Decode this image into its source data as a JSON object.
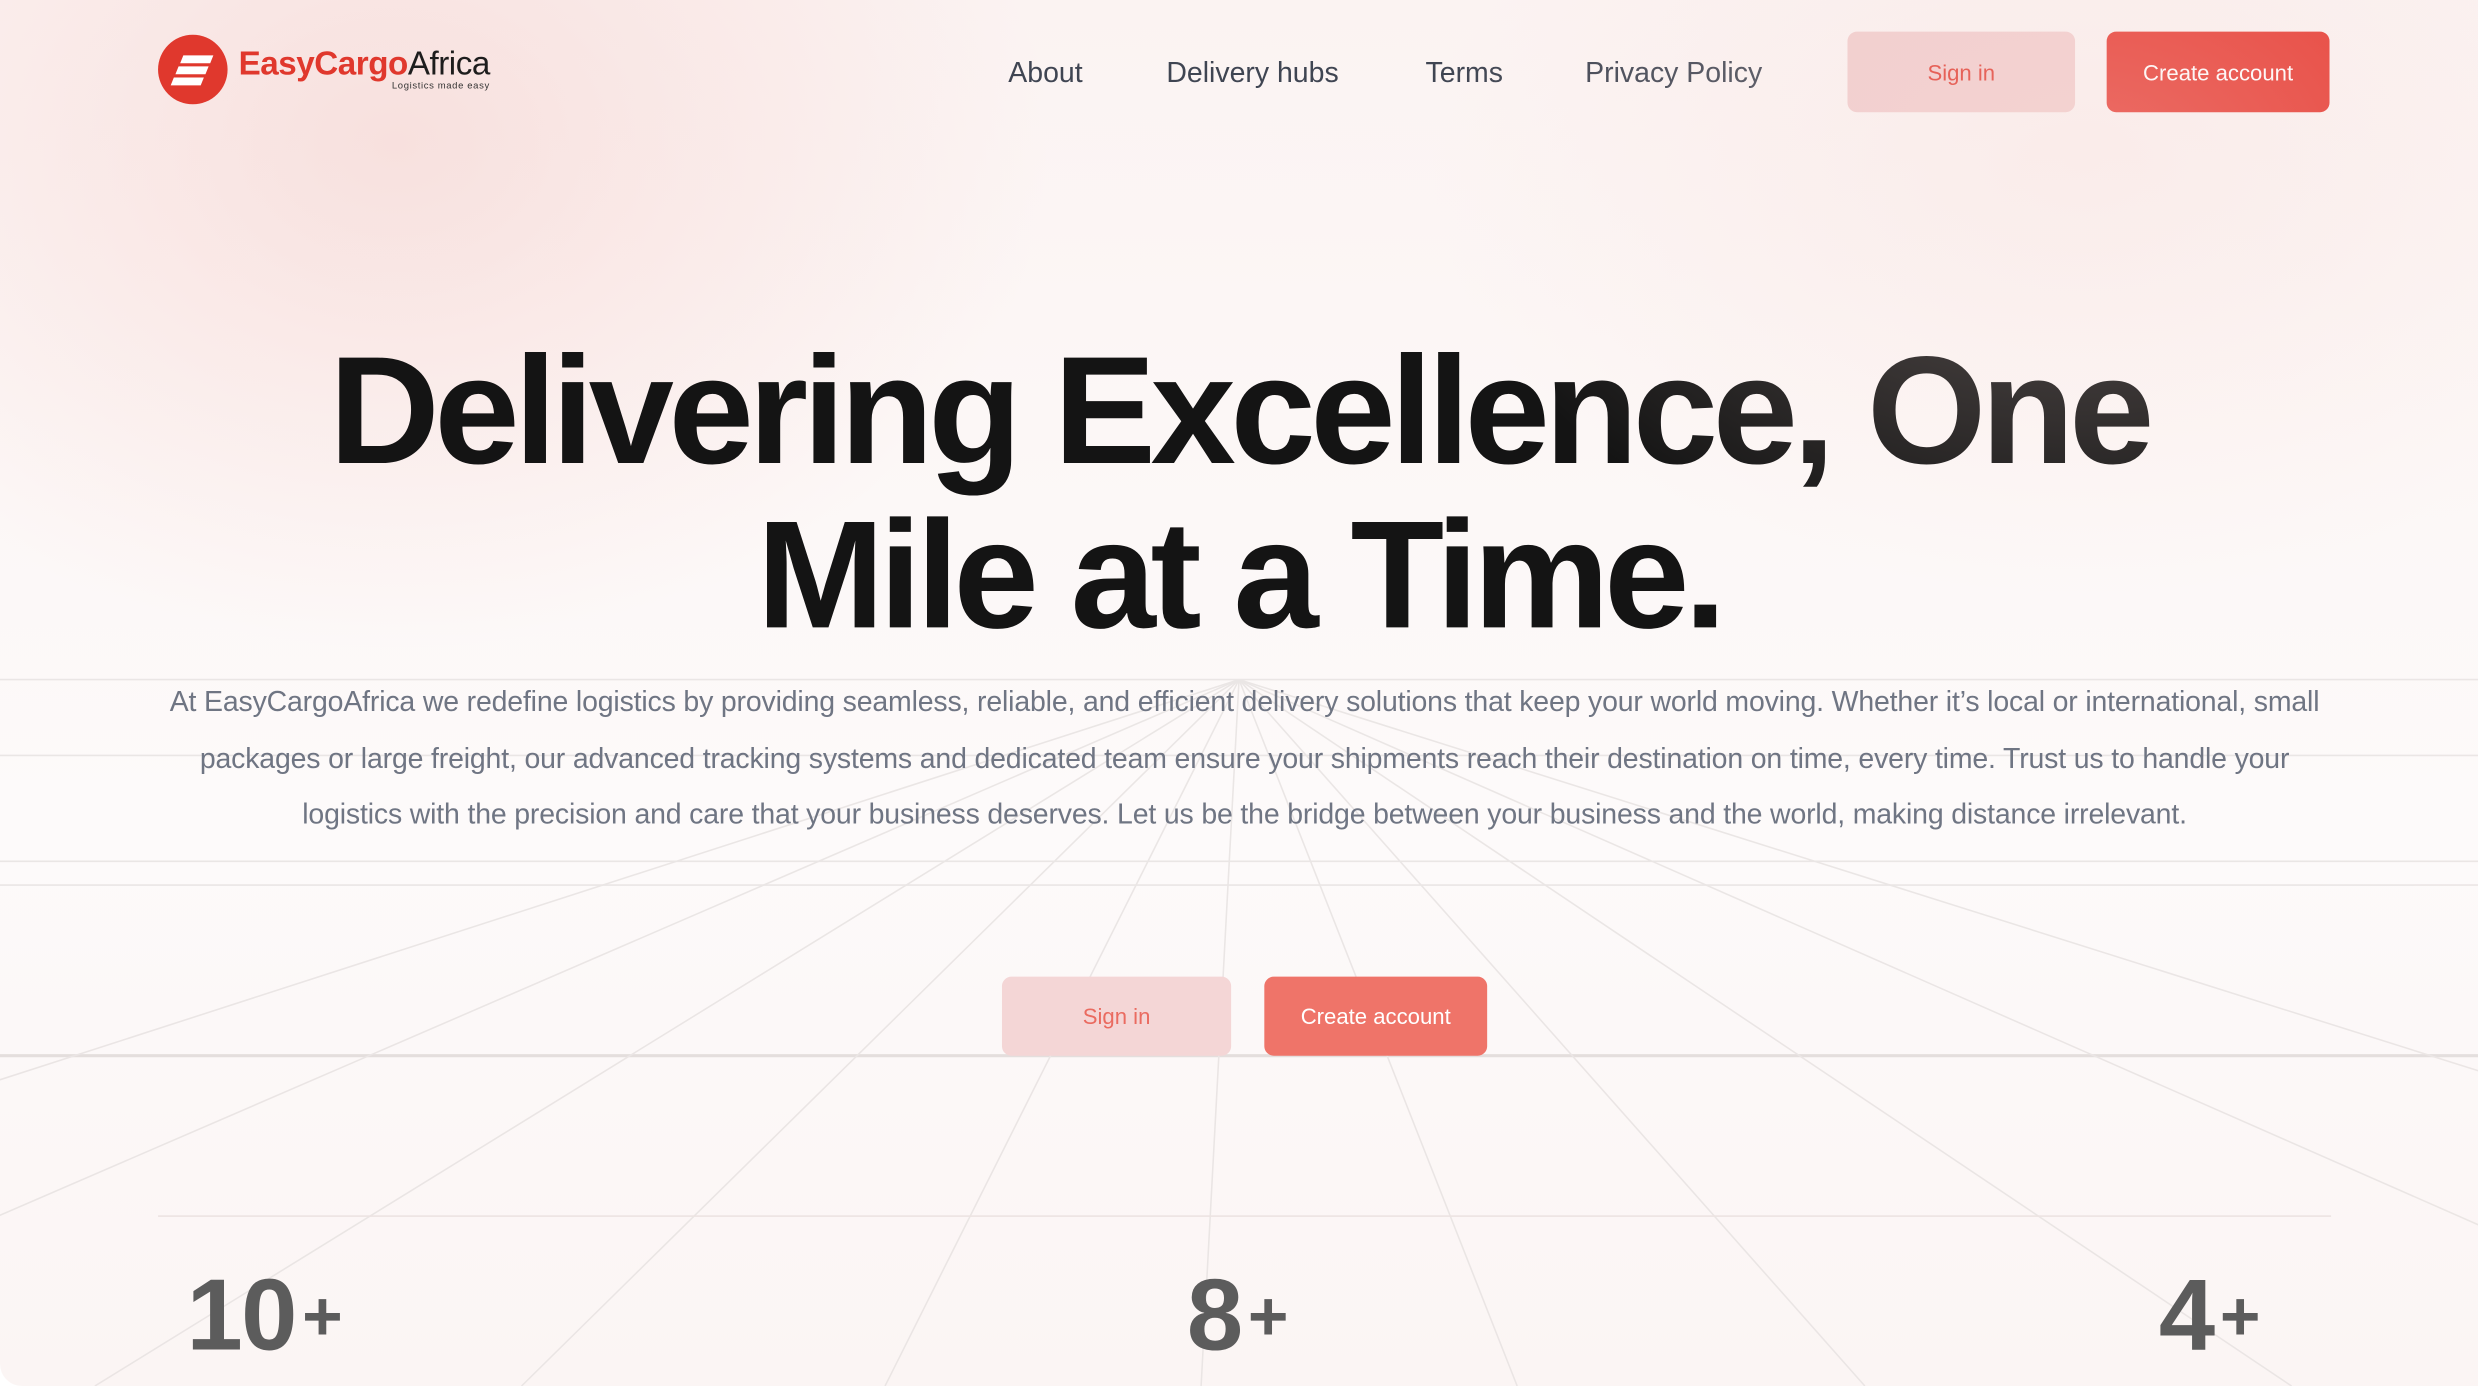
{
  "brand": {
    "name_easy": "Easy",
    "name_cargo": "Cargo",
    "name_africa": "Africa",
    "tagline": "Logistics made easy",
    "accent_color": "#e0382d"
  },
  "nav": {
    "links": [
      {
        "label": "About"
      },
      {
        "label": "Delivery hubs"
      },
      {
        "label": "Terms"
      },
      {
        "label": "Privacy Policy"
      }
    ],
    "sign_in": "Sign in",
    "create_account": "Create account"
  },
  "hero": {
    "title_line1": "Delivering Excellence, One",
    "title_line2": "Mile at a Time.",
    "body": "At EasyCargoAfrica we redefine logistics by providing seamless, reliable, and efficient delivery solutions that keep your world moving. Whether it’s local or international, small packages or large freight, our advanced tracking systems and dedicated team ensure your shipments reach their destination on time, every time. Trust us to handle your logistics with the precision and care that your business deserves. Let us be the bridge between your business and the world, making distance irrelevant.",
    "sign_in": "Sign in",
    "create_account": "Create account"
  },
  "stats": [
    {
      "value": "10",
      "suffix": "+"
    },
    {
      "value": "8",
      "suffix": "+"
    },
    {
      "value": "4",
      "suffix": "+"
    }
  ]
}
